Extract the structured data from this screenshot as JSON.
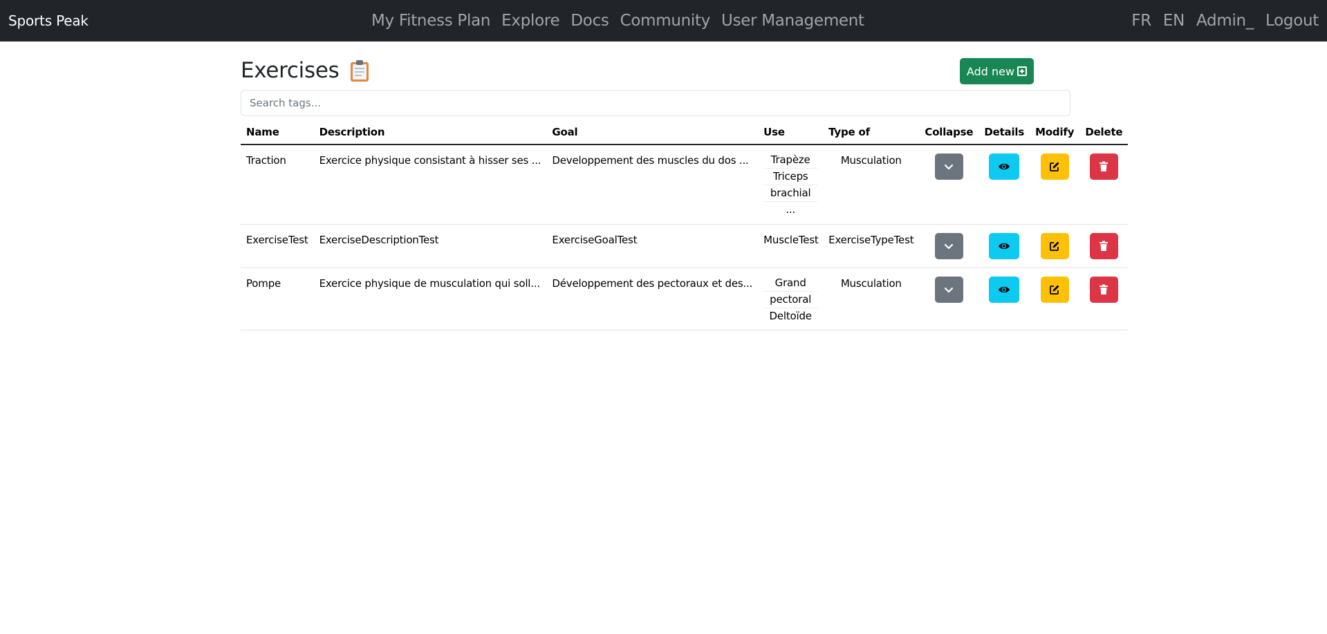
{
  "navbar": {
    "brand": "Sports Peak",
    "links": [
      "My Fitness Plan",
      "Explore",
      "Docs",
      "Community",
      "User Management"
    ],
    "right": [
      "FR",
      "EN",
      "Admin_",
      "Logout"
    ]
  },
  "page": {
    "title": "Exercises",
    "add_label": "Add new",
    "search_placeholder": "Search tags..."
  },
  "table": {
    "headers": [
      "Name",
      "Description",
      "Goal",
      "Use",
      "Type of",
      "Collapse",
      "Details",
      "Modify",
      "Delete"
    ],
    "rows": [
      {
        "name": "Traction",
        "description": "Exercice physique consistant à hisser ses ...",
        "goal": "Developpement des muscles du dos ...",
        "use": [
          "Trapèze",
          "Triceps",
          "brachial",
          "..."
        ],
        "type": "Musculation"
      },
      {
        "name": "ExerciseTest",
        "description": "ExerciseDescriptionTest",
        "goal": "ExerciseGoalTest",
        "use": [
          "MuscleTest"
        ],
        "type": "ExerciseTypeTest"
      },
      {
        "name": "Pompe",
        "description": "Exercice physique de musculation qui soll...",
        "goal": "Développement des pectoraux et des...",
        "use": [
          "Grand",
          "pectoral",
          "Deltoïde"
        ],
        "type": "Musculation"
      }
    ]
  },
  "colors": {
    "navbar": "#212529",
    "success": "#198754",
    "secondary": "#6c757d",
    "info": "#0dcaf0",
    "warning": "#ffc107",
    "danger": "#dc3545"
  },
  "icons": {
    "collapse": "chevron-down-icon",
    "details": "eye-icon",
    "modify": "pencil-square-icon",
    "delete": "trash-icon",
    "add": "plus-square-icon",
    "title": "clipboard-icon"
  }
}
